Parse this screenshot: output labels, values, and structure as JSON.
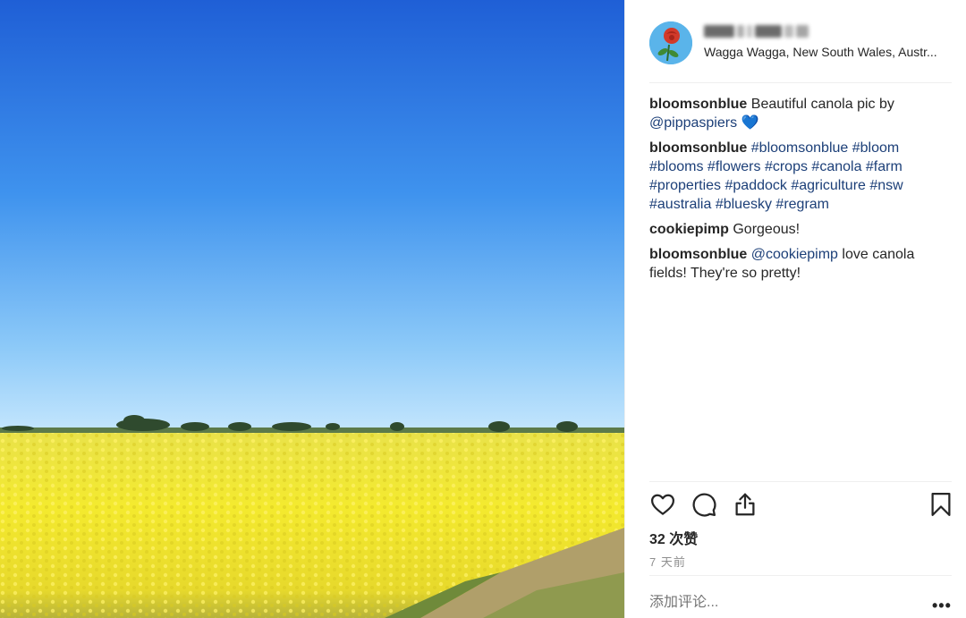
{
  "post": {
    "location": "Wagga Wagga, New South Wales, Austr...",
    "photo": "canola-field-under-blue-sky"
  },
  "comments": [
    {
      "user": "bloomsonblue",
      "text": " Beautiful canola pic by ",
      "mention": "@pippaspiers",
      "emoji": " 💙"
    },
    {
      "user": "bloomsonblue",
      "tags": "#bloomsonblue #bloom #blooms #flowers #crops #canola #farm #properties #paddock #agriculture #nsw #australia #bluesky #regram"
    },
    {
      "user": "cookiepimp",
      "text": " Gorgeous!"
    },
    {
      "user": "bloomsonblue",
      "mention": "@cookiepimp",
      "text": " love canola fields! They're so pretty!"
    }
  ],
  "actions": {
    "like_icon": "heart-icon",
    "comment_icon": "comment-icon",
    "share_icon": "share-icon",
    "save_icon": "bookmark-icon"
  },
  "likes": "32 次赞",
  "time": "7 天前",
  "add_comment_placeholder": "添加评论...",
  "more": "•••",
  "colors": {
    "link": "#1c3f78",
    "text": "#262626",
    "muted": "#8e8e8e",
    "sky_top": "#1f63d6",
    "field": "#f2e83a"
  }
}
